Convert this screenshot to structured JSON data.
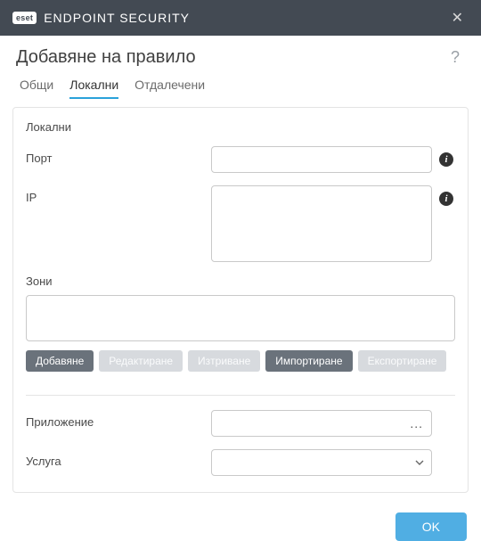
{
  "titlebar": {
    "brand_badge": "eset",
    "brand_text_light": "ENDPOINT ",
    "brand_text_strong": "SECURITY"
  },
  "header": {
    "title": "Добавяне на правило"
  },
  "tabs": [
    {
      "label": "Общи",
      "active": false
    },
    {
      "label": "Локални",
      "active": true
    },
    {
      "label": "Отдалечени",
      "active": false
    }
  ],
  "section": {
    "heading": "Локални",
    "port_label": "Порт",
    "port_value": "",
    "ip_label": "IP",
    "ip_value": "",
    "zones_label": "Зони",
    "zones_value": ""
  },
  "zone_buttons": {
    "add": "Добавяне",
    "edit": "Редактиране",
    "delete": "Изтриване",
    "import": "Импортиране",
    "export": "Експортиране"
  },
  "app": {
    "label": "Приложение",
    "value": ""
  },
  "service": {
    "label": "Услуга",
    "value": ""
  },
  "footer": {
    "ok": "OK"
  }
}
